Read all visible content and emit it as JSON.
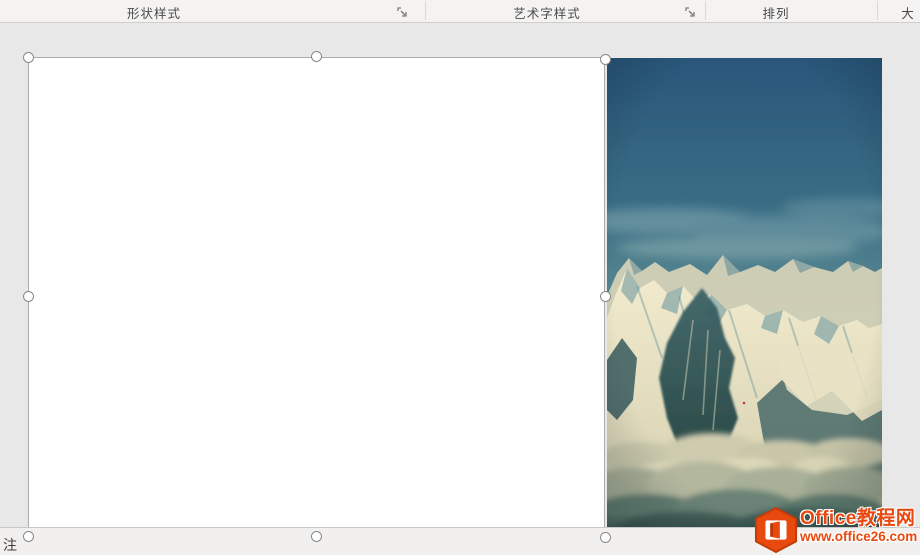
{
  "ribbon": {
    "groups": [
      {
        "label": "形状样式"
      },
      {
        "label": "艺术字样式"
      },
      {
        "label": "排列"
      },
      {
        "label": "大"
      }
    ]
  },
  "canvas": {
    "notes_label": "注",
    "image": {
      "alt": "snow-mountains-above-clouds-photo"
    }
  },
  "watermark": {
    "title": "Office教程网",
    "url": "www.office26.com"
  },
  "colors": {
    "accent_orange": "#e8490f",
    "sky_blue": "#2a5877",
    "selection_border": "#ababab",
    "handle_border": "#898989"
  }
}
